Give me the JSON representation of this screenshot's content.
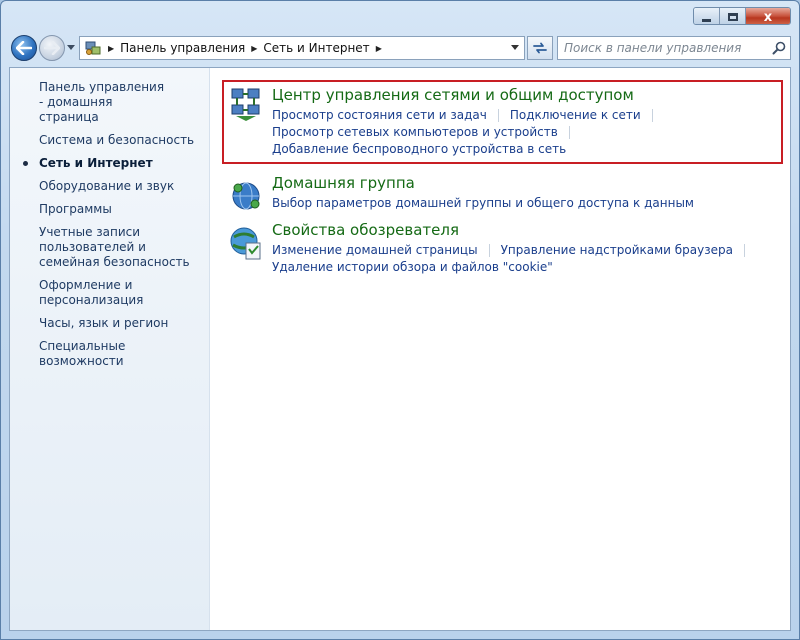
{
  "window": {
    "close_glyph": "x"
  },
  "navbar": {
    "breadcrumbs": [
      "Панель управления",
      "Сеть и Интернет"
    ],
    "search_placeholder": "Поиск в панели управления"
  },
  "sidebar": {
    "items": [
      {
        "label": "Панель управления - домашняя страница",
        "active": false
      },
      {
        "label": "Система и безопасность",
        "active": false
      },
      {
        "label": "Сеть и Интернет",
        "active": true
      },
      {
        "label": "Оборудование и звук",
        "active": false
      },
      {
        "label": "Программы",
        "active": false
      },
      {
        "label": "Учетные записи пользователей и семейная безопасность",
        "active": false
      },
      {
        "label": "Оформление и персонализация",
        "active": false
      },
      {
        "label": "Часы, язык и регион",
        "active": false
      },
      {
        "label": "Специальные возможности",
        "active": false
      }
    ]
  },
  "categories": [
    {
      "title": "Центр управления сетями и общим доступом",
      "icon": "network-center-icon",
      "highlighted": true,
      "rows": [
        [
          "Просмотр состояния сети и задач",
          "Подключение к сети"
        ],
        [
          "Просмотр сетевых компьютеров и устройств"
        ],
        [
          "Добавление беспроводного устройства в сеть"
        ]
      ]
    },
    {
      "title": "Домашняя группа",
      "icon": "homegroup-icon",
      "highlighted": false,
      "rows": [
        [
          "Выбор параметров домашней группы и общего доступа к данным"
        ]
      ]
    },
    {
      "title": "Свойства обозревателя",
      "icon": "internet-options-icon",
      "highlighted": false,
      "rows": [
        [
          "Изменение домашней страницы",
          "Управление надстройками браузера"
        ],
        [
          "Удаление истории обзора и файлов \"cookie\""
        ]
      ]
    }
  ],
  "colors": {
    "highlight_border": "#c81e24",
    "category_title": "#156a15",
    "task_link": "#1a3e8c",
    "sidebar_text": "#1f3b63"
  }
}
